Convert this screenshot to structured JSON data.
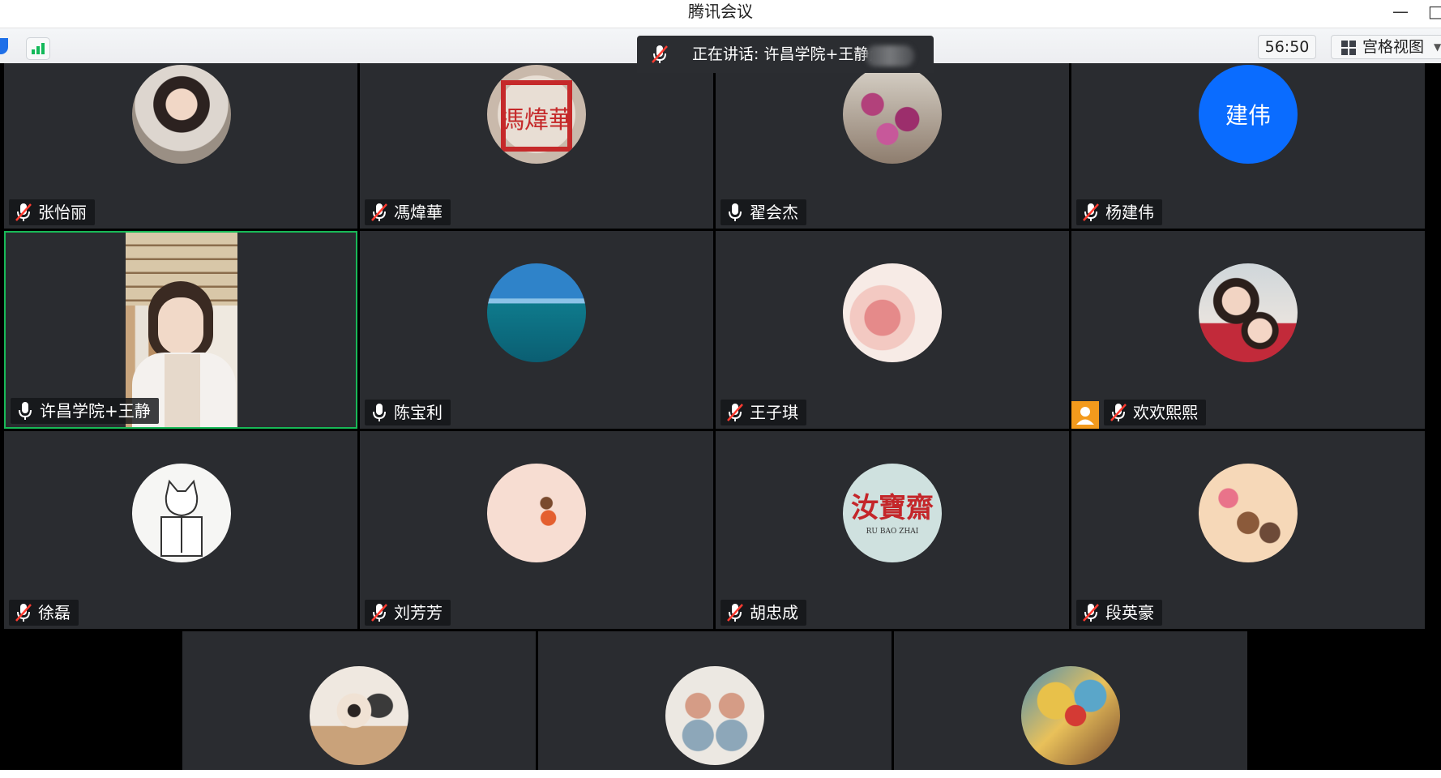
{
  "app": {
    "window_title": "腾讯会议"
  },
  "toolbar": {
    "timer": "56:50",
    "view_mode_label": "宫格视图"
  },
  "speaking_banner": {
    "text": "正在讲话: 许昌学院+王静;"
  },
  "participants": [
    {
      "name": "张怡丽",
      "mic": "muted",
      "avatar": "photo"
    },
    {
      "name": "馮煒華",
      "mic": "muted",
      "avatar": "seal-image",
      "avatar_text": "馮煒華"
    },
    {
      "name": "翟会杰",
      "mic": "on",
      "avatar": "flower-photo"
    },
    {
      "name": "杨建伟",
      "mic": "muted",
      "avatar": "text",
      "avatar_text": "建伟",
      "avatar_color": "#0a6cff"
    },
    {
      "name": "许昌学院+王静",
      "mic": "on",
      "avatar": "video",
      "speaking": true
    },
    {
      "name": "陈宝利",
      "mic": "on",
      "avatar": "sea-photo"
    },
    {
      "name": "王子琪",
      "mic": "muted",
      "avatar": "hands-photo"
    },
    {
      "name": "欢欢熙熙",
      "mic": "muted",
      "avatar": "family-photo",
      "host": true
    },
    {
      "name": "徐磊",
      "mic": "muted",
      "avatar": "cat-drawing"
    },
    {
      "name": "刘芳芳",
      "mic": "muted",
      "avatar": "girl-illustration"
    },
    {
      "name": "胡忠成",
      "mic": "muted",
      "avatar": "logo",
      "avatar_text": "汝寶齋",
      "avatar_subtext": "RU BAO ZHAI"
    },
    {
      "name": "段英豪",
      "mic": "muted",
      "avatar": "children-illustration"
    },
    {
      "name": "",
      "avatar": "dancer-photo"
    },
    {
      "name": "",
      "avatar": "monks-figurine"
    },
    {
      "name": "",
      "avatar": "colorful-portrait"
    }
  ],
  "icons": {
    "mic_on": "microphone-icon",
    "mic_muted": "muted-microphone-icon",
    "host": "host-badge-icon",
    "signal": "network-signal-icon",
    "grid": "grid-view-icon"
  },
  "colors": {
    "accent_green": "#18b957",
    "tile_bg": "#2a2c30",
    "host_orange": "#f39a1c",
    "avatar_blue": "#0a6cff"
  }
}
